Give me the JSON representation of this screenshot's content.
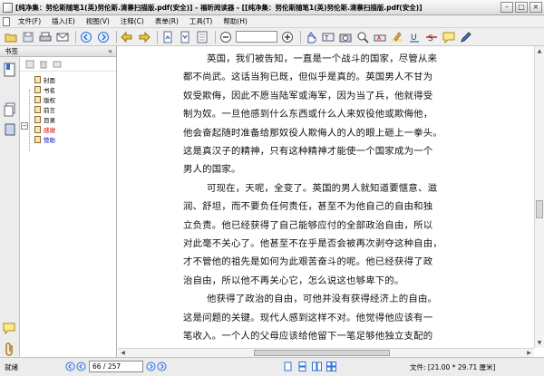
{
  "window": {
    "title": "[纯净集：努伦斯随笔1(英)努伦斯.清寨扫描版.pdf(安全)] - 福昕阅读器 - [[纯净集：努伦斯随笔1(英)努伦斯.清寨扫描版.pdf(安全)]",
    "minimize": "–",
    "maximize": "□",
    "close": "×"
  },
  "menu": {
    "items": [
      "文件(F)",
      "插入(E)",
      "视图(V)",
      "注释(C)",
      "表单(R)",
      "工具(T)",
      "帮助(H)"
    ]
  },
  "toolbar": {
    "zoom_value": "",
    "colors": {
      "accent": "#2f6fd6",
      "hand": "#3355aa"
    }
  },
  "sidebar": {
    "header": "书签",
    "collapse": "«",
    "expand_symbol": "−",
    "bookmarks": [
      {
        "label": "封面",
        "color": "#000000"
      },
      {
        "label": "书名",
        "color": "#000000"
      },
      {
        "label": "版权",
        "color": "#000000"
      },
      {
        "label": "前言",
        "color": "#000000"
      },
      {
        "label": "目录",
        "color": "#000000"
      },
      {
        "label": "感谢",
        "color": "#cc0000"
      },
      {
        "label": "赞助",
        "color": "#0000cc"
      }
    ]
  },
  "document": {
    "lines": [
      "英国，我们被告知，一直是一个战斗的国家，尽管从来",
      "都不尚武。这话当狗已既，但似乎是真的。英国男人不甘为",
      "奴受欺侮，因此不愿当陆军或海军，因为当了兵，他就得受",
      "制为奴。一旦他感到什么东西或什么人来奴役他或欺侮他，",
      "他会奋起随时准备给那奴役人欺侮人的人的眼上砸上一拳头。",
      "这是真汉子的精神，只有这种精神才能使一个国家成为一个",
      "男人的国家。",
      "可现在，天呢，全变了。英国的男人就知道要惬意、滋",
      "润、舒坦，而不要负任何责任，甚至不为他自己的自由和独",
      "立负责。他已经获得了自己能够应付的全部政治自由，所以",
      "对此毫不关心了。他甚至不在乎是否会被再次剥夺这种自由，",
      "才不管他的祖先是如何为此艰苦奋斗的呢。他已经获得了政",
      "治自由，所以他不再关心它，怎么说这也够卑下的。",
      "他获得了政治的自由，可他并没有获得经济上的自由。",
      "这是问题的关键。现代人感到这样不对。他觉得他应该有一",
      "笔收入。一个人的父母应该给他留下一笔足够他独立支配的"
    ],
    "indented": [
      true,
      false,
      false,
      false,
      false,
      false,
      false,
      true,
      false,
      false,
      false,
      false,
      false,
      true,
      false,
      false
    ]
  },
  "statusbar": {
    "ready": "就绪",
    "page_value": "66 / 257",
    "file_size": "文件: [21.00 * 29.71 厘米]"
  }
}
